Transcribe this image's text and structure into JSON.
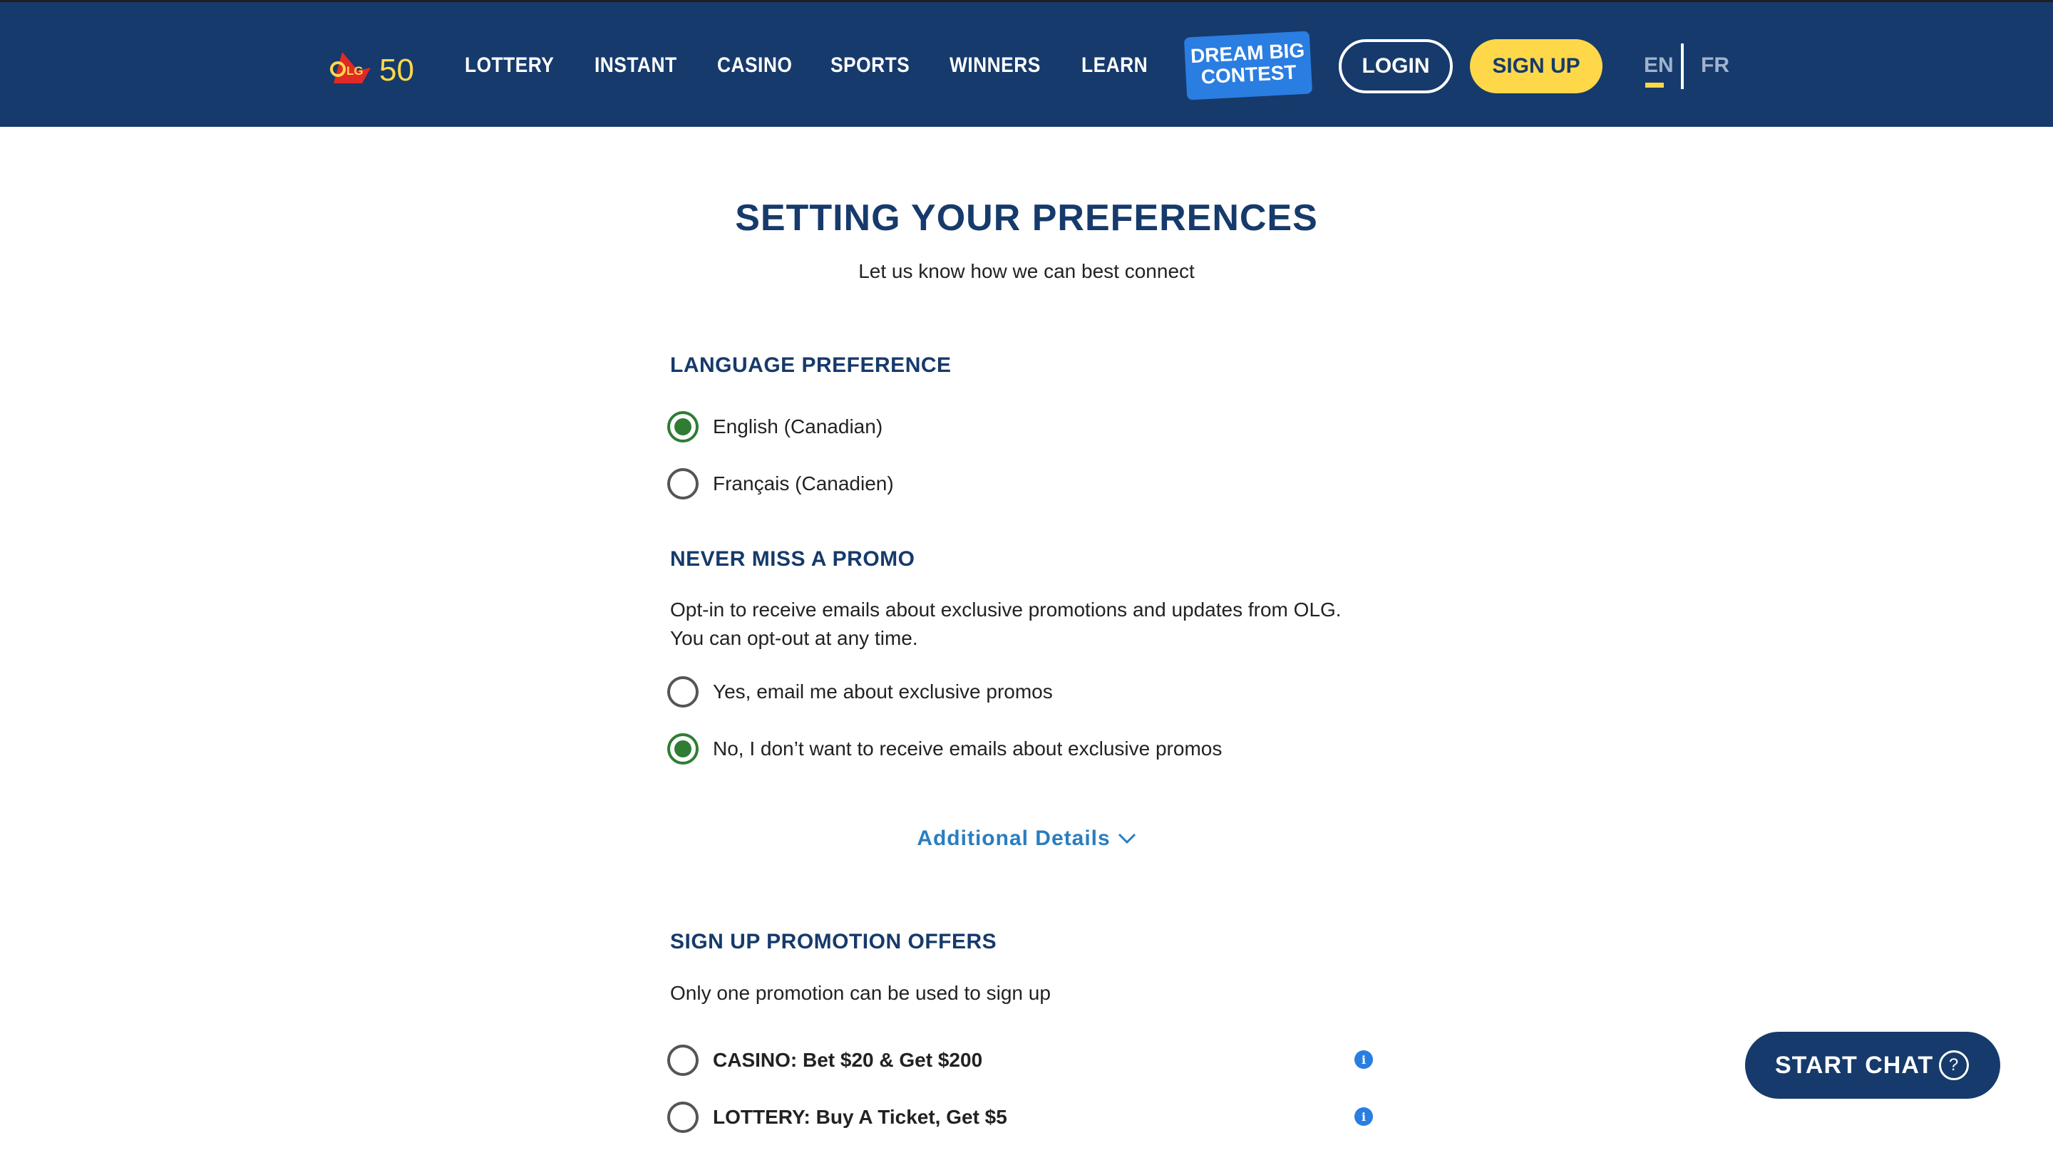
{
  "header": {
    "logo_text": "OLG 50",
    "nav": [
      "LOTTERY",
      "INSTANT",
      "CASINO",
      "SPORTS",
      "WINNERS",
      "LEARN"
    ],
    "dream_big_line1": "DREAM BIG",
    "dream_big_line2": "CONTEST",
    "login_label": "LOGIN",
    "signup_label": "SIGN UP",
    "lang_en": "EN",
    "lang_fr": "FR"
  },
  "page": {
    "title": "SETTING YOUR PREFERENCES",
    "subtitle": "Let us know how we can best connect"
  },
  "language": {
    "heading": "LANGUAGE PREFERENCE",
    "options": [
      {
        "label": "English (Canadian)",
        "checked": true
      },
      {
        "label": "Français (Canadien)",
        "checked": false
      }
    ]
  },
  "promo": {
    "heading": "NEVER MISS A PROMO",
    "description": "Opt-in to receive emails about exclusive promotions and updates from OLG. You can opt-out at any time.",
    "options": [
      {
        "label": "Yes, email me about exclusive promos",
        "checked": false
      },
      {
        "label": "No, I don’t want to receive emails about exclusive promos",
        "checked": true
      }
    ]
  },
  "additional_details": "Additional Details",
  "signup_offers": {
    "heading": "SIGN UP PROMOTION OFFERS",
    "description": "Only one promotion can be used to sign up",
    "options": [
      {
        "label": "CASINO: Bet $20 & Get $200",
        "checked": false
      },
      {
        "label": "LOTTERY: Buy A Ticket, Get $5",
        "checked": false
      }
    ]
  },
  "chat": {
    "label": "START CHAT",
    "icon": "question-circle-icon"
  },
  "colors": {
    "header_bg": "#163a6b",
    "accent_yellow": "#ffd84a",
    "accent_blue": "#2a7de1",
    "radio_checked": "#2e7d32",
    "heading_navy": "#163a6b"
  }
}
